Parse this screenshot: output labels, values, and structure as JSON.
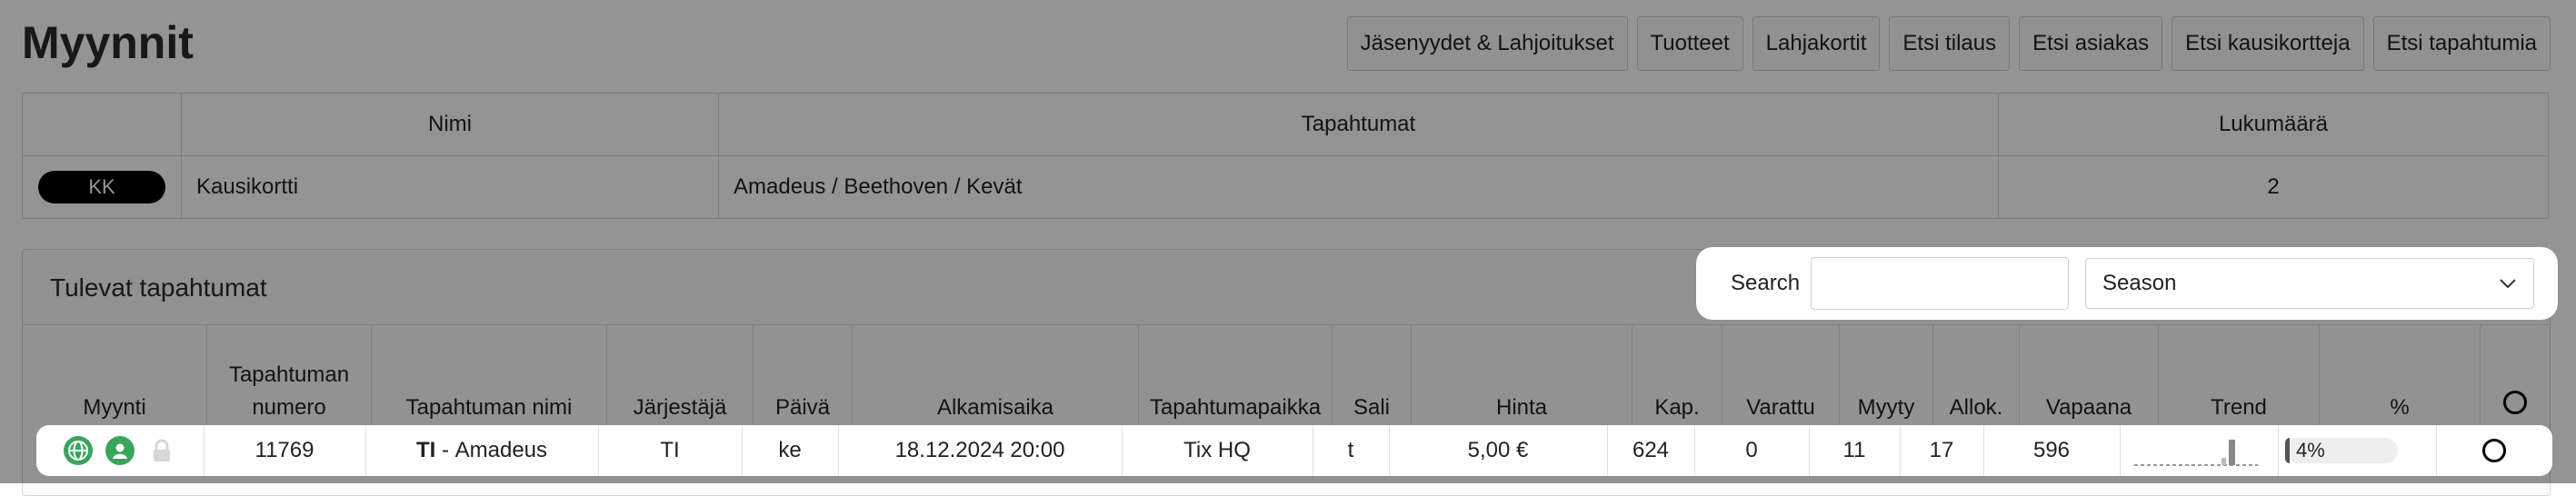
{
  "page": {
    "title": "Myynnit"
  },
  "top_buttons": [
    {
      "label": "Jäsenyydet & Lahjoitukset"
    },
    {
      "label": "Tuotteet"
    },
    {
      "label": "Lahjakortit"
    },
    {
      "label": "Etsi tilaus"
    },
    {
      "label": "Etsi asiakas"
    },
    {
      "label": "Etsi kausikortteja"
    },
    {
      "label": "Etsi tapahtumia"
    }
  ],
  "season_cards": {
    "headers": [
      "",
      "Nimi",
      "Tapahtumat",
      "Lukumäärä"
    ],
    "row": {
      "badge": "KK",
      "name": "Kausikortti",
      "events": "Amadeus / Beethoven / Kevät",
      "count": "2"
    }
  },
  "upcoming": {
    "title": "Tulevat tapahtumat",
    "search_label": "Search",
    "season_select": "Season",
    "headers": [
      "Myynti",
      "Tapahtuman numero",
      "Tapahtuman nimi",
      "Järjestäjä",
      "Päivä",
      "Alkamisaika",
      "Tapahtumapaikka",
      "Sali",
      "Hinta",
      "Kap.",
      "Varattu",
      "Myyty",
      "Allok.",
      "Vapaana",
      "Trend",
      "%"
    ],
    "row": {
      "number": "11769",
      "organizer_code": "TI",
      "event_name": "Amadeus",
      "organizer": "TI",
      "day": "ke",
      "start": "18.12.2024 20:00",
      "venue": "Tix HQ",
      "hall": "t",
      "price": "5,00 €",
      "capacity": "624",
      "reserved": "0",
      "sold": "11",
      "allocated": "17",
      "available": "596",
      "percent": "4%",
      "percent_value": 0.04
    },
    "icons": [
      "globe-icon",
      "user-icon",
      "lock-icon"
    ]
  },
  "colors": {
    "accent_green": "#3aa55d",
    "badge": "#000000"
  }
}
